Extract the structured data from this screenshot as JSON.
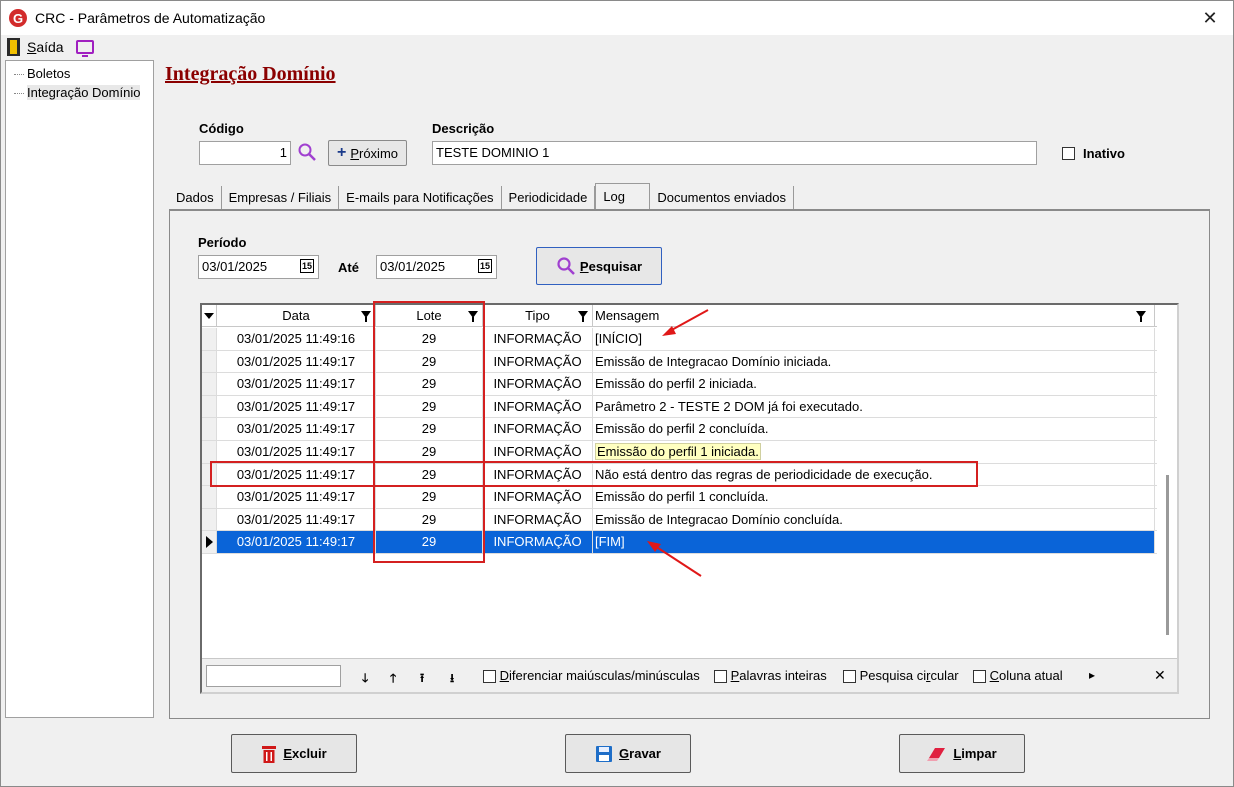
{
  "window": {
    "title": "CRC - Parâmetros de Automatização",
    "app_icon_letter": "G"
  },
  "menubar": {
    "saida_first": "S",
    "saida_rest": "aída"
  },
  "tree": {
    "items": [
      {
        "label": "Boletos"
      },
      {
        "label": "Integração Domínio"
      }
    ]
  },
  "page": {
    "title": "Integração Domínio"
  },
  "form": {
    "codigo_label": "Código",
    "codigo_value": "1",
    "proximo_first": "P",
    "proximo_rest": "róximo",
    "descricao_label": "Descrição",
    "descricao_value": "TESTE DOMINIO 1",
    "inativo_label": "Inativo"
  },
  "tabs": [
    {
      "label": "Dados"
    },
    {
      "label": "Empresas / Filiais"
    },
    {
      "label": "E-mails para Notificações"
    },
    {
      "label": "Periodicidade"
    },
    {
      "label": "Log"
    },
    {
      "label": "Documentos enviados"
    }
  ],
  "log": {
    "periodo_label": "Período",
    "from_date": "03/01/2025",
    "ate_label": "Até",
    "to_date": "03/01/2025",
    "calendar_glyph": "15",
    "pesquisar_first": "P",
    "pesquisar_rest": "esquisar"
  },
  "grid": {
    "columns": [
      "Data",
      "Lote",
      "Tipo",
      "Mensagem"
    ],
    "rows": [
      {
        "data": "03/01/2025 11:49:16",
        "lote": "29",
        "tipo": "INFORMAÇÃO",
        "mensagem": "[INÍCIO]"
      },
      {
        "data": "03/01/2025 11:49:17",
        "lote": "29",
        "tipo": "INFORMAÇÃO",
        "mensagem": "Emissão de Integracao Domínio iniciada."
      },
      {
        "data": "03/01/2025 11:49:17",
        "lote": "29",
        "tipo": "INFORMAÇÃO",
        "mensagem": "Emissão do perfil 2 iniciada."
      },
      {
        "data": "03/01/2025 11:49:17",
        "lote": "29",
        "tipo": "INFORMAÇÃO",
        "mensagem": "Parâmetro 2 - TESTE 2 DOM já foi executado."
      },
      {
        "data": "03/01/2025 11:49:17",
        "lote": "29",
        "tipo": "INFORMAÇÃO",
        "mensagem": "Emissão do perfil 2 concluída."
      },
      {
        "data": "03/01/2025 11:49:17",
        "lote": "29",
        "tipo": "INFORMAÇÃO",
        "mensagem": "Emissão do perfil 1 iniciada."
      },
      {
        "data": "03/01/2025 11:49:17",
        "lote": "29",
        "tipo": "INFORMAÇÃO",
        "mensagem": "Não está dentro das regras de periodicidade de execução."
      },
      {
        "data": "03/01/2025 11:49:17",
        "lote": "29",
        "tipo": "INFORMAÇÃO",
        "mensagem": "Emissão do perfil 1 concluída."
      },
      {
        "data": "03/01/2025 11:49:17",
        "lote": "29",
        "tipo": "INFORMAÇÃO",
        "mensagem": "Emissão de Integracao Domínio concluída."
      },
      {
        "data": "03/01/2025 11:49:17",
        "lote": "29",
        "tipo": "INFORMAÇÃO",
        "mensagem": "[FIM]"
      }
    ],
    "selected_row": 9,
    "highlighted_row": 5
  },
  "findbar": {
    "opt1_first": "D",
    "opt1_rest": "iferenciar maiúsculas/minúsculas",
    "opt2_first": "P",
    "opt2_rest": "alavras inteiras",
    "opt3_a": "Pesquisa ci",
    "opt3_u": "r",
    "opt3_b": "cular",
    "opt4_a": "C",
    "opt4_rest": "oluna atual"
  },
  "buttons": {
    "excluir_first": "E",
    "excluir_rest": "xcluir",
    "gravar_first": "G",
    "gravar_rest": "ravar",
    "limpar_first": "L",
    "limpar_rest": "impar"
  },
  "colors": {
    "accent_title": "#8b0000",
    "selection": "#0a64d8",
    "annotation_red": "#d42020",
    "highlight_yellow": "#ffffc0"
  }
}
